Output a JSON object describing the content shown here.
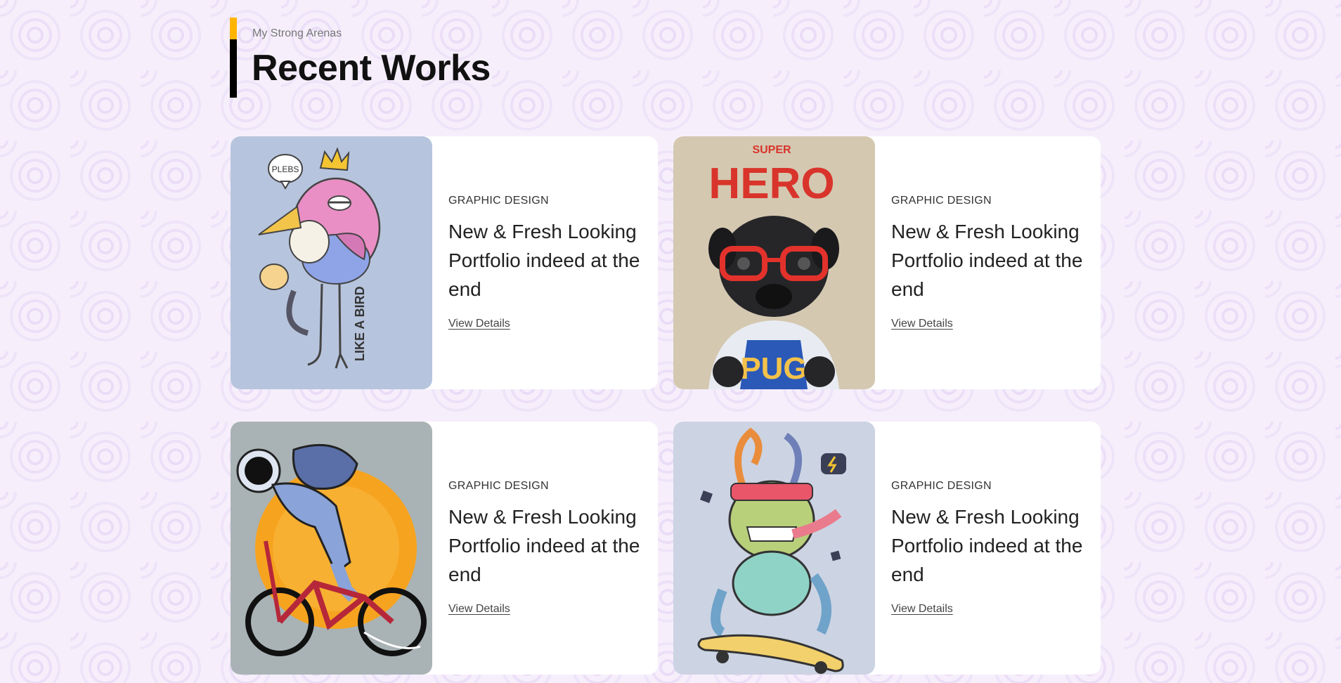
{
  "section": {
    "subtitle": "My Strong Arenas",
    "title": "Recent Works"
  },
  "cards": [
    {
      "image": "bird-illustration",
      "category": "GRAPHIC DESIGN",
      "title": "New & Fresh Looking Portfolio indeed at the end",
      "link": "View Details",
      "image_text": [
        "PLEBS",
        "LIKE A BIRD"
      ],
      "bg": "#b7c4dd"
    },
    {
      "image": "superhero-pug-illustration",
      "category": "GRAPHIC DESIGN",
      "title": "New & Fresh Looking Portfolio indeed at the end",
      "link": "View Details",
      "image_text": [
        "SUPER",
        "HERO",
        "PUG"
      ],
      "bg": "#d4c8b1"
    },
    {
      "image": "astronaut-bicycle-illustration",
      "category": "GRAPHIC DESIGN",
      "title": "New & Fresh Looking Portfolio indeed at the end",
      "link": "View Details",
      "image_text": [],
      "bg": "#a9b3b5"
    },
    {
      "image": "monster-skateboard-illustration",
      "category": "GRAPHIC DESIGN",
      "title": "New & Fresh Looking Portfolio indeed at the end",
      "link": "View Details",
      "image_text": [],
      "bg": "#ccd3e3"
    }
  ],
  "colors": {
    "accent": "#ffb400",
    "heading_bar": "#000000"
  }
}
